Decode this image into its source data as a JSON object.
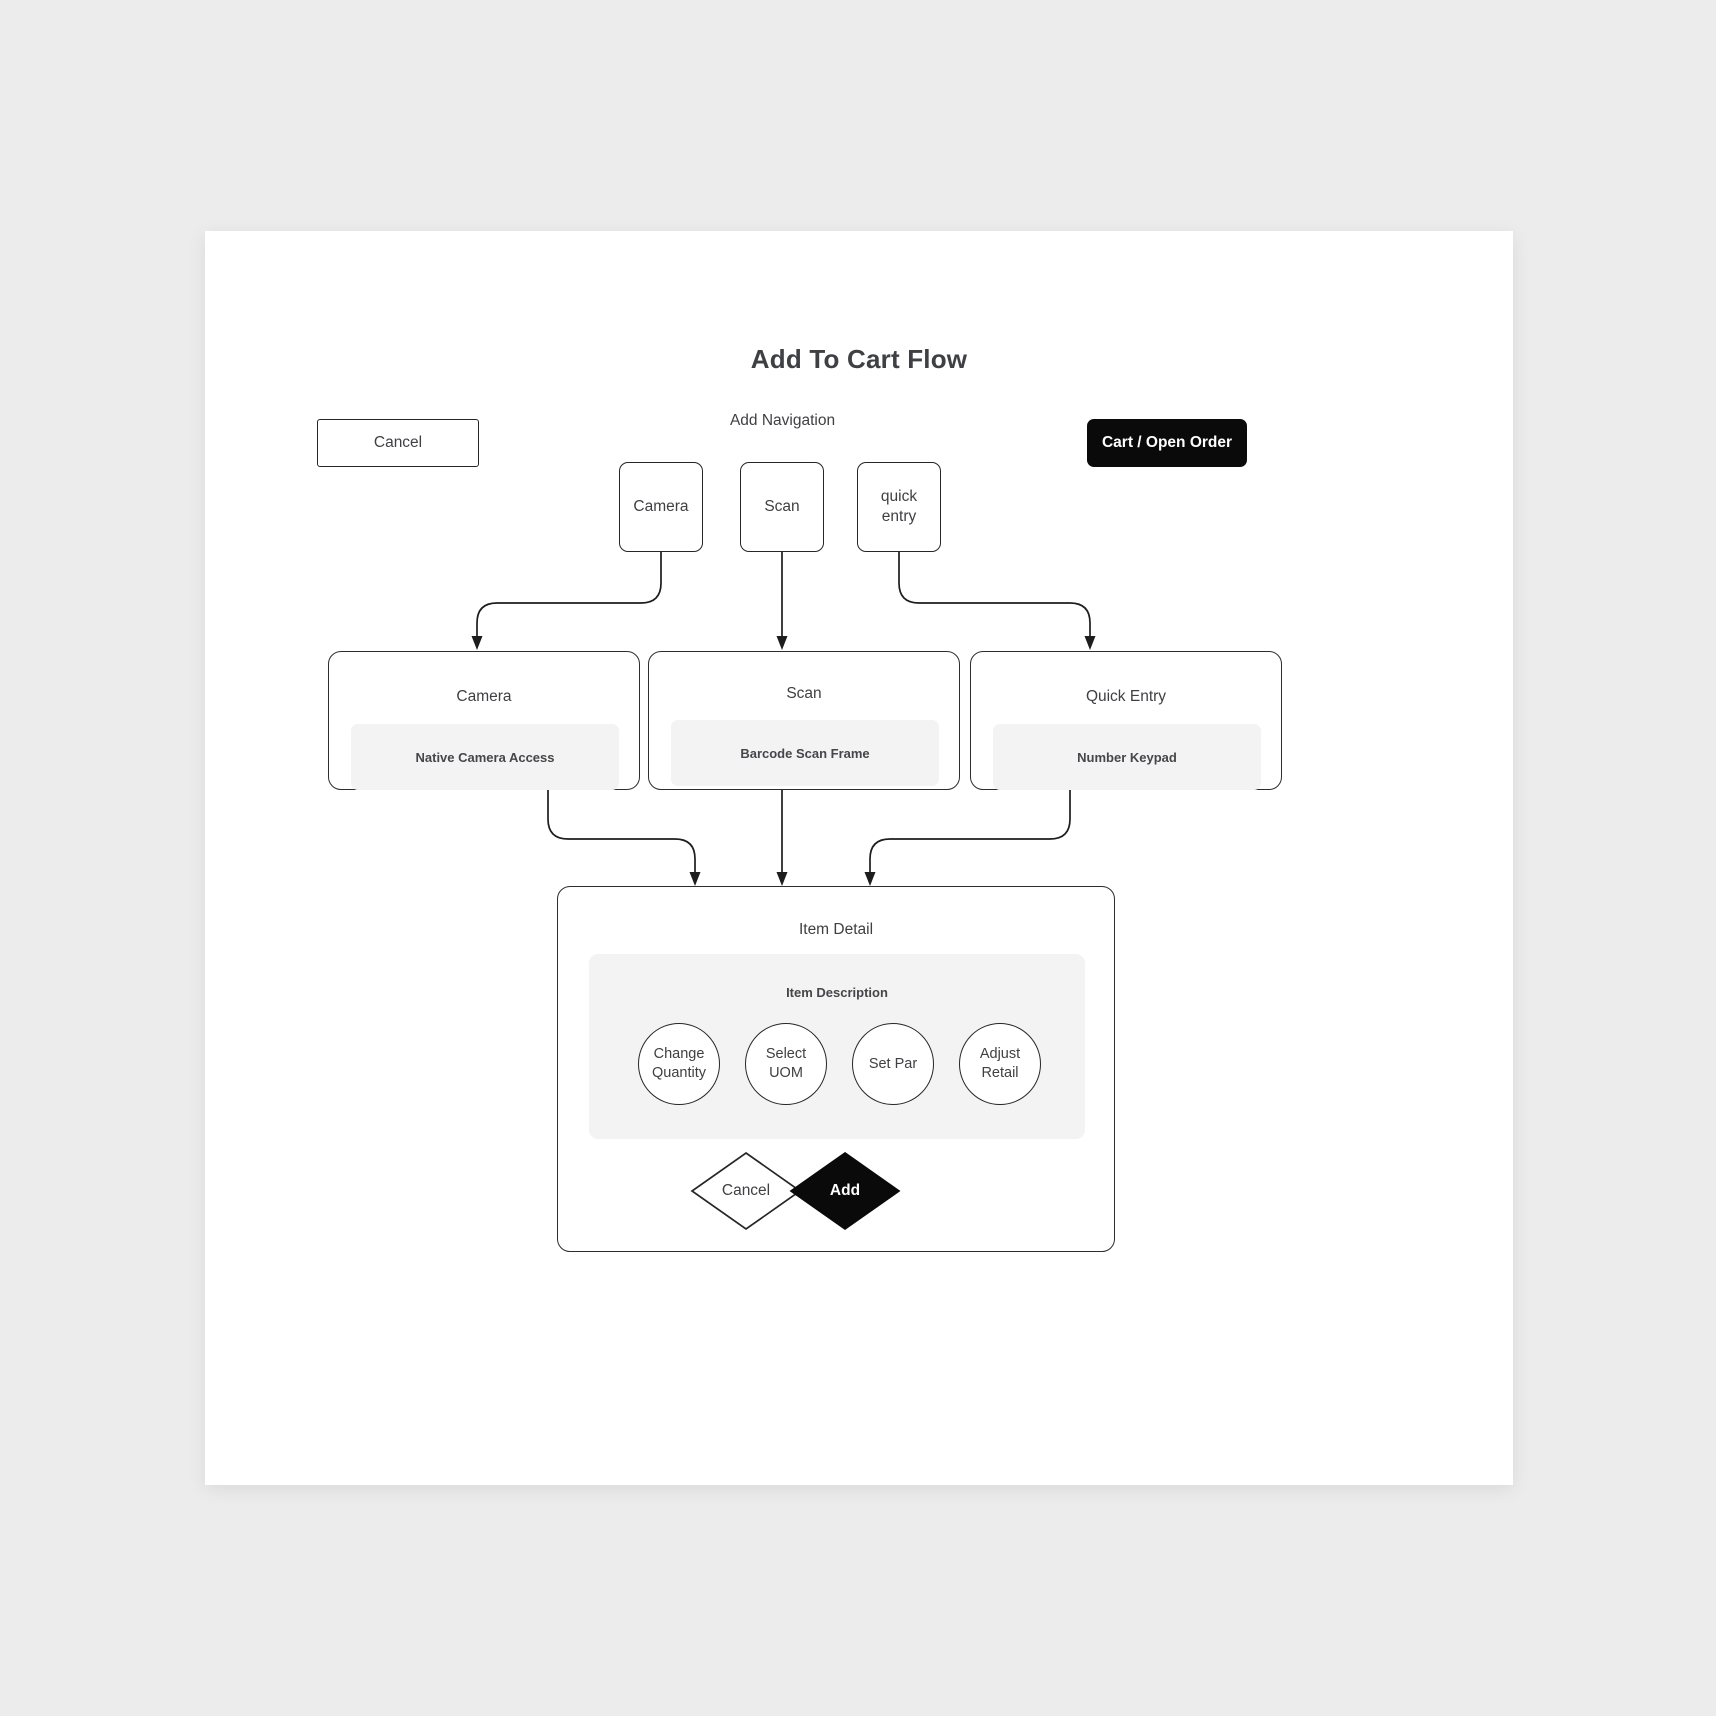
{
  "page": {
    "title": "Add To Cart Flow",
    "background_color": "#ececec",
    "canvas_color": "#ffffff",
    "accent_dark": "#0a0a0a",
    "panel_fill": "#f3f3f3",
    "stroke_color": "#262626",
    "text_color": "#3f4043"
  },
  "top_row": {
    "cancel_label": "Cancel",
    "group_label": "Add Navigation",
    "cart_label": "Cart / Open Order"
  },
  "nav_boxes": [
    {
      "label": "Camera"
    },
    {
      "label": "Scan"
    },
    {
      "label": "quick\nentry"
    }
  ],
  "screens": [
    {
      "title": "Camera",
      "panel_label": "Native Camera Access"
    },
    {
      "title": "Scan",
      "panel_label": "Barcode Scan Frame"
    },
    {
      "title": "Quick Entry",
      "panel_label": "Number Keypad"
    }
  ],
  "item_detail": {
    "title": "Item Detail",
    "description_label": "Item Description",
    "actions": [
      {
        "label": "Change\nQuantity"
      },
      {
        "label": "Select\nUOM"
      },
      {
        "label": "Set Par"
      },
      {
        "label": "Adjust\nRetail"
      }
    ],
    "cancel_label": "Cancel",
    "add_label": "Add"
  }
}
